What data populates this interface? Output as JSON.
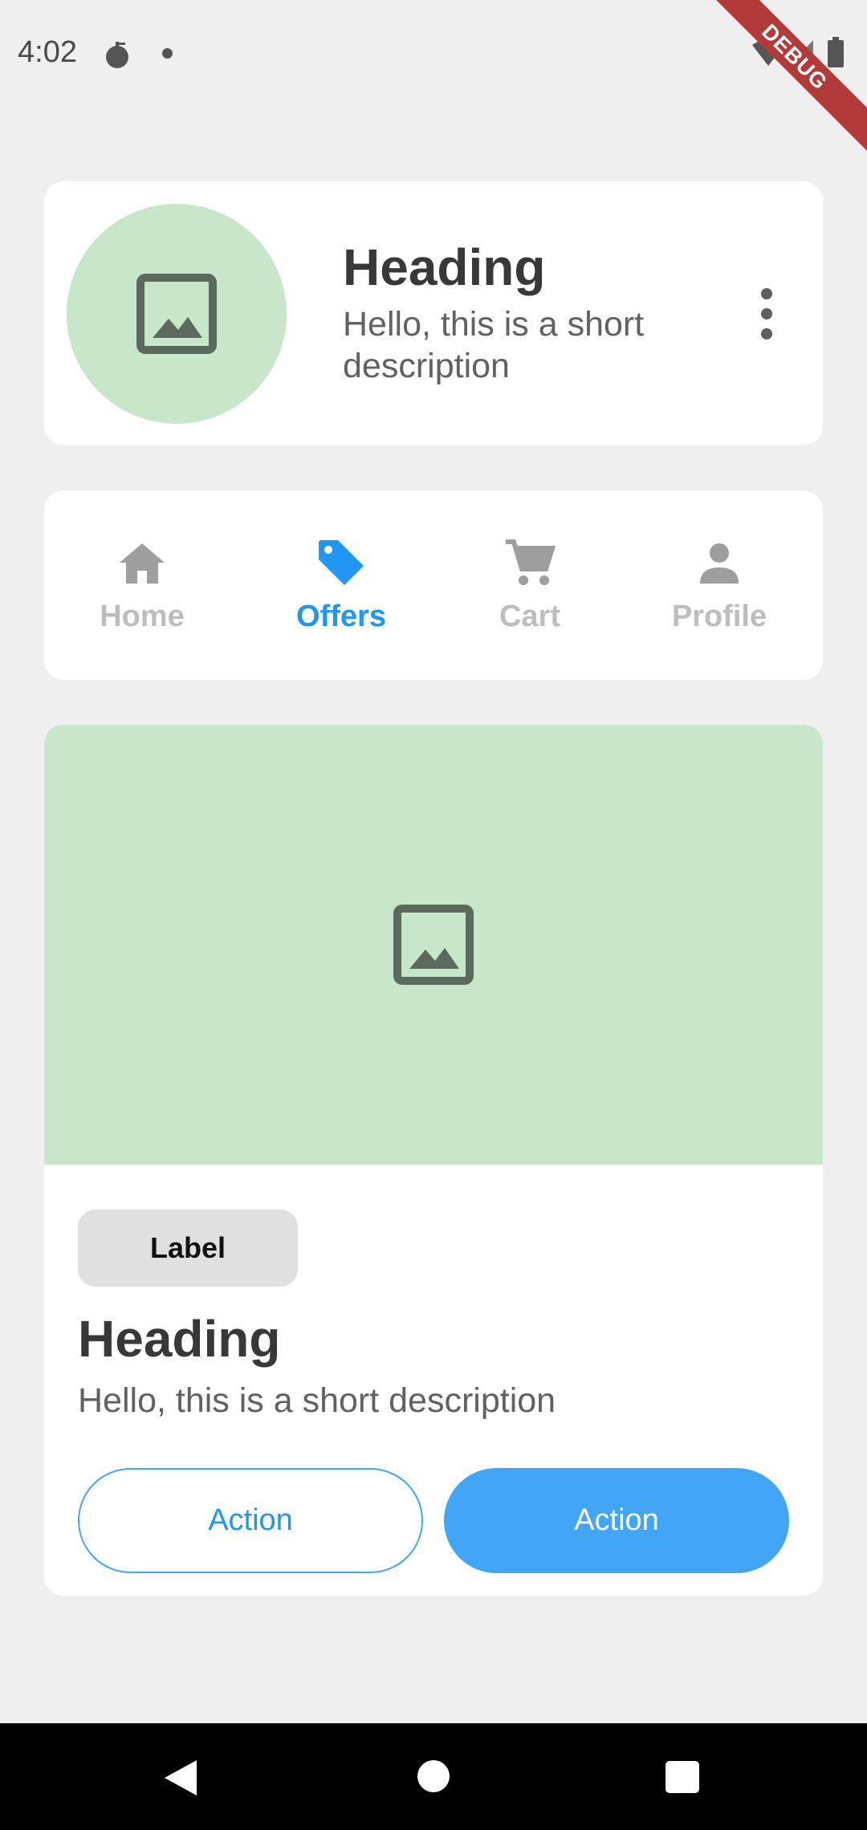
{
  "status_bar": {
    "time": "4:02",
    "icons": [
      "bug-icon",
      "dot-icon",
      "wifi-icon",
      "signal-icon",
      "battery-icon"
    ]
  },
  "debug_banner": "DEBUG",
  "header_card": {
    "title": "Heading",
    "description": "Hello, this is a short description",
    "avatar_icon": "image-icon",
    "menu_icon": "more-vert-icon"
  },
  "tabs": [
    {
      "label": "Home",
      "icon": "home-icon",
      "active": false
    },
    {
      "label": "Offers",
      "icon": "tag-icon",
      "active": true
    },
    {
      "label": "Cart",
      "icon": "cart-icon",
      "active": false
    },
    {
      "label": "Profile",
      "icon": "person-icon",
      "active": false
    }
  ],
  "content_card": {
    "image_icon": "image-icon",
    "chip_label": "Label",
    "title": "Heading",
    "description": "Hello, this is a short description",
    "secondary_action": "Action",
    "primary_action": "Action"
  },
  "nav_bar": {
    "back_icon": "back-icon",
    "home_icon": "home-circle-icon",
    "recents_icon": "recents-icon"
  },
  "colors": {
    "accent": "#2196f3",
    "button_fill": "#42a5f5",
    "image_placeholder": "#c8e6c9",
    "chip": "#e0e0e0",
    "background": "#efefef"
  }
}
